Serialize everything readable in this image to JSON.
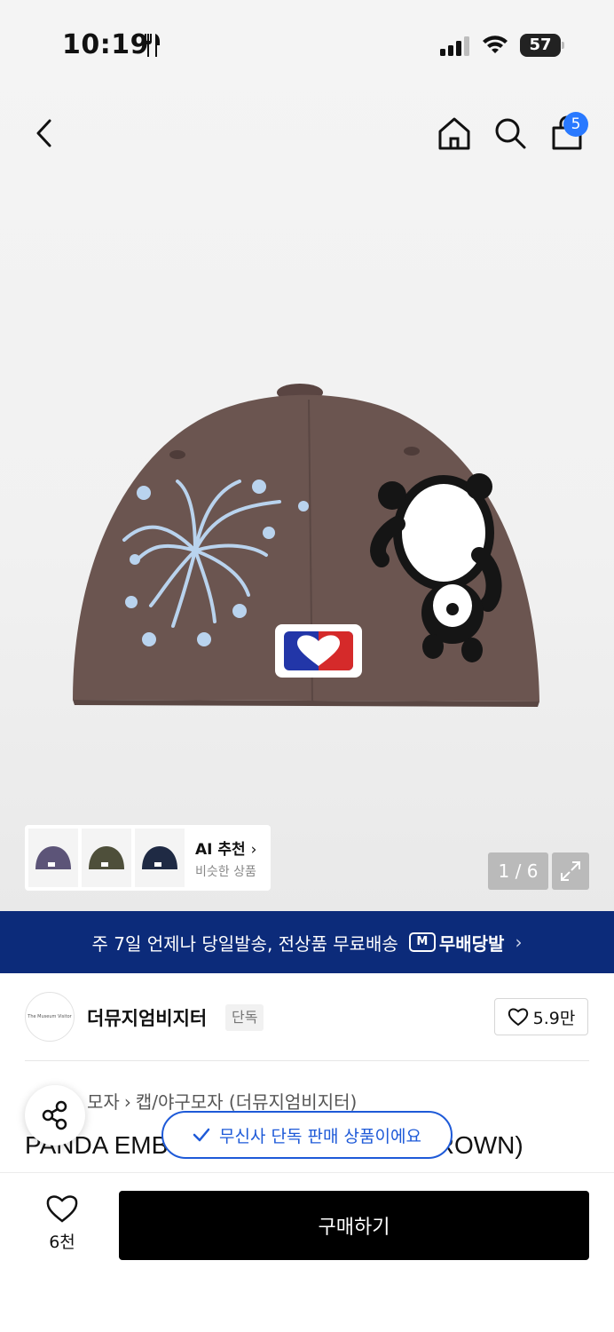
{
  "status_bar": {
    "time": "10:19",
    "battery": "57"
  },
  "nav": {
    "cart_count": "5"
  },
  "ai_card": {
    "title": "AI 추천",
    "subtitle": "비슷한 상품"
  },
  "gallery": {
    "counter": "1 / 6"
  },
  "banner": {
    "text": "주 7일 언제나 당일발송, 전상품 무료배송",
    "badge": "무배당발",
    "badge_icon": "M"
  },
  "brand": {
    "logo_text": "The Museum Visitor",
    "name": "더뮤지엄비지터",
    "tag": "단독",
    "likes": "5.9만"
  },
  "breadcrumb": {
    "item1": "모자",
    "item2": "캡/야구모자 (더뮤지엄비지터)"
  },
  "product": {
    "title": "PANDA EMBROIDERY BALL CAP (BROWN)"
  },
  "toast": {
    "text": "무신사 단독 판매 상품이에요"
  },
  "bottom": {
    "wish_count": "6천",
    "buy_label": "구매하기"
  },
  "colors": {
    "banner": "#0c2b7a",
    "toast": "#1e5ad8",
    "badge": "#2979ff",
    "cap": "#6b5550"
  }
}
